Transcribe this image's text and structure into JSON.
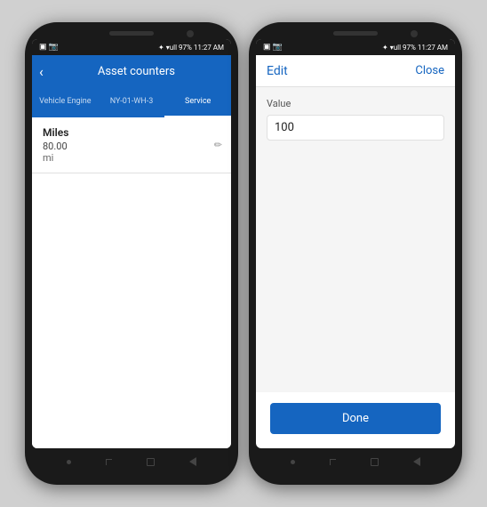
{
  "phone1": {
    "statusBar": {
      "left": "🔵 📷",
      "battery": "97%",
      "time": "11:27 AM",
      "signal": "✦ ▾ull"
    },
    "navTitle": "Asset counters",
    "backIcon": "‹",
    "tabs": [
      {
        "id": "vehicle-engine",
        "label": "Vehicle Engine",
        "active": false
      },
      {
        "id": "ny-01-wh-3",
        "label": "NY-01-WH-3",
        "active": false
      },
      {
        "id": "service",
        "label": "Service",
        "active": true
      }
    ],
    "counters": [
      {
        "label": "Miles",
        "value": "80.00",
        "unit": "mi"
      }
    ],
    "navButtons": {
      "dot": "•",
      "corner": "⌐",
      "square": "□",
      "back": "←"
    }
  },
  "phone2": {
    "statusBar": {
      "left": "🔵 📷",
      "battery": "97%",
      "time": "11:27 AM",
      "signal": "✦ ▾ull"
    },
    "editTitle": "Edit",
    "closeLabel": "Close",
    "fieldLabel": "Value",
    "fieldValue": "100",
    "doneLabel": "Done"
  }
}
